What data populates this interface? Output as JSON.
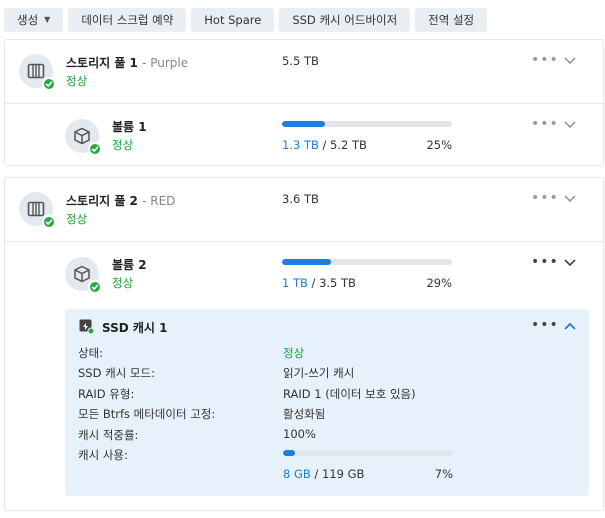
{
  "toolbar": {
    "create": "생성",
    "scrub": "데이터 스크럽 예약",
    "hot_spare": "Hot Spare",
    "ssd_advisor": "SSD 캐시 어드바이저",
    "global_settings": "전역 설정"
  },
  "pool1": {
    "title": "스토리지 풀 1",
    "subtitle": "- Purple",
    "status": "정상",
    "size": "5.5 TB",
    "volume": {
      "title": "볼륨 1",
      "status": "정상",
      "used": "1.3 TB",
      "total": " / 5.2 TB",
      "percent_text": "25%",
      "fraction": 0.25
    }
  },
  "pool2": {
    "title": "스토리지 풀 2",
    "subtitle": "- RED",
    "status": "정상",
    "size": "3.6 TB",
    "volume": {
      "title": "볼륨 2",
      "status": "정상",
      "used": "1 TB",
      "total": " / 3.5 TB",
      "percent_text": "29%",
      "fraction": 0.29
    },
    "cache": {
      "title": "SSD 캐시 1",
      "fields": [
        {
          "label": "상태:",
          "value": "정상"
        },
        {
          "label": "SSD 캐시 모드:",
          "value": "읽기-쓰기 캐시"
        },
        {
          "label": "RAID 유형:",
          "value": "RAID 1 (데이터 보호 있음)"
        },
        {
          "label": "모든 Btrfs 메타데이터 고정:",
          "value": "활성화됨"
        },
        {
          "label": "캐시 적중률:",
          "value": "100%"
        },
        {
          "label": "캐시 사용:",
          "value": ""
        }
      ],
      "used": "8 GB",
      "total": " / 119 GB",
      "percent_text": "7%",
      "fraction": 0.07
    }
  },
  "colors": {
    "accent": "#1b7ee0",
    "ok": "#1aa33a",
    "panel": "#e6f1fb"
  },
  "icons": {
    "pool": "nas-drive-icon",
    "volume": "cube-icon",
    "cache": "ssd-cache-icon",
    "status": "check-circle-icon",
    "more": "more-dots-icon",
    "expand": "chevron-down-icon",
    "collapse": "chevron-up-icon"
  }
}
